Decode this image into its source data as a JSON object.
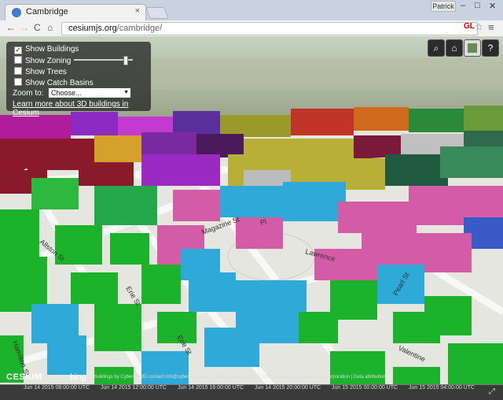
{
  "browser": {
    "tab_title": "Cambridge",
    "tab_close": "×",
    "profile_label": "Patrick",
    "window_controls": [
      "–",
      "□",
      "✕"
    ],
    "nav": {
      "back": "←",
      "forward": "→",
      "reload": "C",
      "home": "⌂"
    },
    "url_host": "cesiumjs.org",
    "url_path": "/cambridge/",
    "extension_label": "GL",
    "star_icon": "☆",
    "menu_icon": "≡"
  },
  "panel": {
    "show_buildings": {
      "label": "Show Buildings",
      "checked": true
    },
    "show_zoning": {
      "label": "Show Zoning",
      "checked": false,
      "slider_value": 0.88
    },
    "show_trees": {
      "label": "Show Trees",
      "checked": false
    },
    "show_catch_basins": {
      "label": "Show Catch Basins",
      "checked": false
    },
    "zoom_label": "Zoom to:",
    "zoom_value": "Choose...",
    "learn_link": "Learn more about 3D buildings in Cesium"
  },
  "cesium_toolbar": [
    "search-icon",
    "home-icon",
    "layers-icon",
    "help-icon"
  ],
  "cesium_toolbar_glyphs": {
    "search": "⌕",
    "home": "⌂",
    "help": "?"
  },
  "streets": [
    "Hamilton St",
    "Erie St",
    "Erie St",
    "Pearl St",
    "Magazine St",
    "Lawrence",
    "Valentine",
    "Allston St",
    "Pl"
  ],
  "credits": {
    "cesium": "CESIUM",
    "bing": "bing",
    "text": "buildings by CyberCity3D contact info@cybercity3d.com | Bing Maps imagery © 2015 HERE © 2015 Microsoft Corporation | Data attribution"
  },
  "timeline_labels": [
    "Jun 14 2015 08:00:00 UTC",
    "Jun 14 2015 12:00:00 UTC",
    "Jun 14 2015 16:00:00 UTC",
    "Jun 14 2015 20:00:00 UTC",
    "Jun 15 2015 00:00:00 UTC",
    "Jun 15 2015 04:00:00 UTC"
  ],
  "fullscreen_icon": "⤢",
  "colors": {
    "accent": "#3d7cc9",
    "green": "#1db22b",
    "blue": "#2ea9d8",
    "pink": "#d45ca7",
    "purple": "#8b2bc2",
    "olive": "#b8b036",
    "red": "#a01a2a"
  }
}
